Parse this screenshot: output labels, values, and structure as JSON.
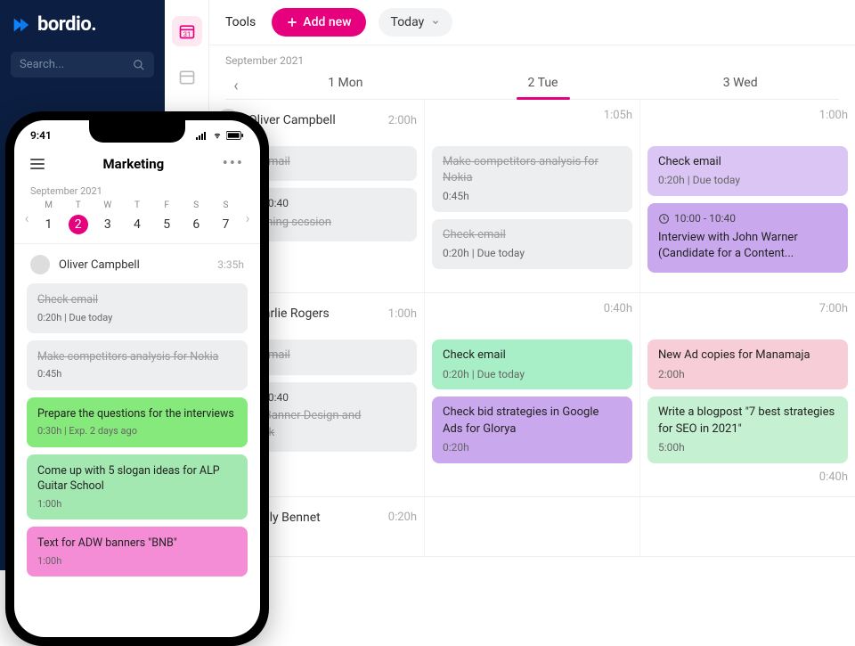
{
  "brand": "bordio.",
  "search_placeholder": "Search...",
  "topbar": {
    "tools": "Tools",
    "add": "Add new",
    "today": "Today"
  },
  "month": "September 2021",
  "days": [
    {
      "label": "1 Mon"
    },
    {
      "label": "2 Tue"
    },
    {
      "label": "3 Wed"
    }
  ],
  "rows": [
    {
      "name": "Oliver Campbell",
      "hours": [
        "2:00h",
        "1:05h",
        "1:00h"
      ],
      "cols": [
        [
          {
            "title": "Check email",
            "meta": "",
            "cls": "g-gray done"
          },
          {
            "title": "Q4 planning session",
            "meta": "",
            "cls": "g-gray done",
            "pre": "10:00 - 10:40"
          }
        ],
        [
          {
            "title": "Make competitors analysis for Nokia",
            "meta": "0:45h",
            "cls": "g-gray done"
          },
          {
            "title": "Check email",
            "meta": "0:20h | Due today",
            "cls": "g-gray done"
          }
        ],
        [
          {
            "title": "Check email",
            "meta": "0:20h | Due today",
            "cls": "g-lpurple"
          },
          {
            "title": "Interview with John Warner (Candidate for a Content...",
            "meta": "",
            "cls": "g-purple",
            "pre": "10:00 - 10:40",
            "clock": true
          }
        ]
      ]
    },
    {
      "name": "Charlie Rogers",
      "hours": [
        "1:00h",
        "0:40h",
        "7:00h"
      ],
      "cols": [
        [
          {
            "title": "Check email",
            "meta": "",
            "cls": "g-gray done"
          },
          {
            "title": "Get FB Banner Design and feedback",
            "meta": "",
            "cls": "g-gray done",
            "pre": "10:00 - 10:40"
          }
        ],
        [
          {
            "title": "Check email",
            "meta": "0:20h | Due today",
            "cls": "g-teal"
          },
          {
            "title": "Check bid strategies in Google Ads for Glorya",
            "meta": "0:20h",
            "cls": "g-purple"
          }
        ],
        [
          {
            "title": "New Ad copies for Manamaja",
            "meta": "2:00h",
            "cls": "g-pink"
          },
          {
            "title": "Write a blogpost \"7 best strategies for SEO in 2021\"",
            "meta": "5:00h",
            "cls": "g-lgreen"
          },
          {
            "title": "",
            "meta": "0:40h",
            "cls": "",
            "right": true
          }
        ]
      ]
    },
    {
      "name": "Emily Bennet",
      "hours": [
        "0:20h",
        "",
        ""
      ],
      "cols": [
        [],
        [],
        []
      ]
    }
  ],
  "phone": {
    "time": "9:41",
    "title": "Marketing",
    "month": "September 2021",
    "days": [
      {
        "n": "M",
        "d": "1"
      },
      {
        "n": "T",
        "d": "2",
        "active": true
      },
      {
        "n": "W",
        "d": "3"
      },
      {
        "n": "T",
        "d": "4"
      },
      {
        "n": "F",
        "d": "5"
      },
      {
        "n": "S",
        "d": "6"
      },
      {
        "n": "S",
        "d": "7"
      }
    ],
    "person": {
      "name": "Oliver Campbell",
      "hrs": "3:35h"
    },
    "cards": [
      {
        "title": "Check email",
        "meta": "0:20h | Due today",
        "cls": "g-gray done"
      },
      {
        "title": "Make competitors analysis for Nokia",
        "meta": "0:45h",
        "cls": "g-gray done"
      },
      {
        "title": "Prepare the questions for the interviews",
        "meta": "0:30h | Exp. 2 days ago",
        "cls": "g-lime"
      },
      {
        "title": "Come up with 5 slogan ideas for ALP Guitar School",
        "meta": "1:00h",
        "cls": "g-mint"
      },
      {
        "title": "Text for ADW banners \"BNB\"",
        "meta": "1:00h",
        "cls": "g-magenta"
      }
    ]
  }
}
